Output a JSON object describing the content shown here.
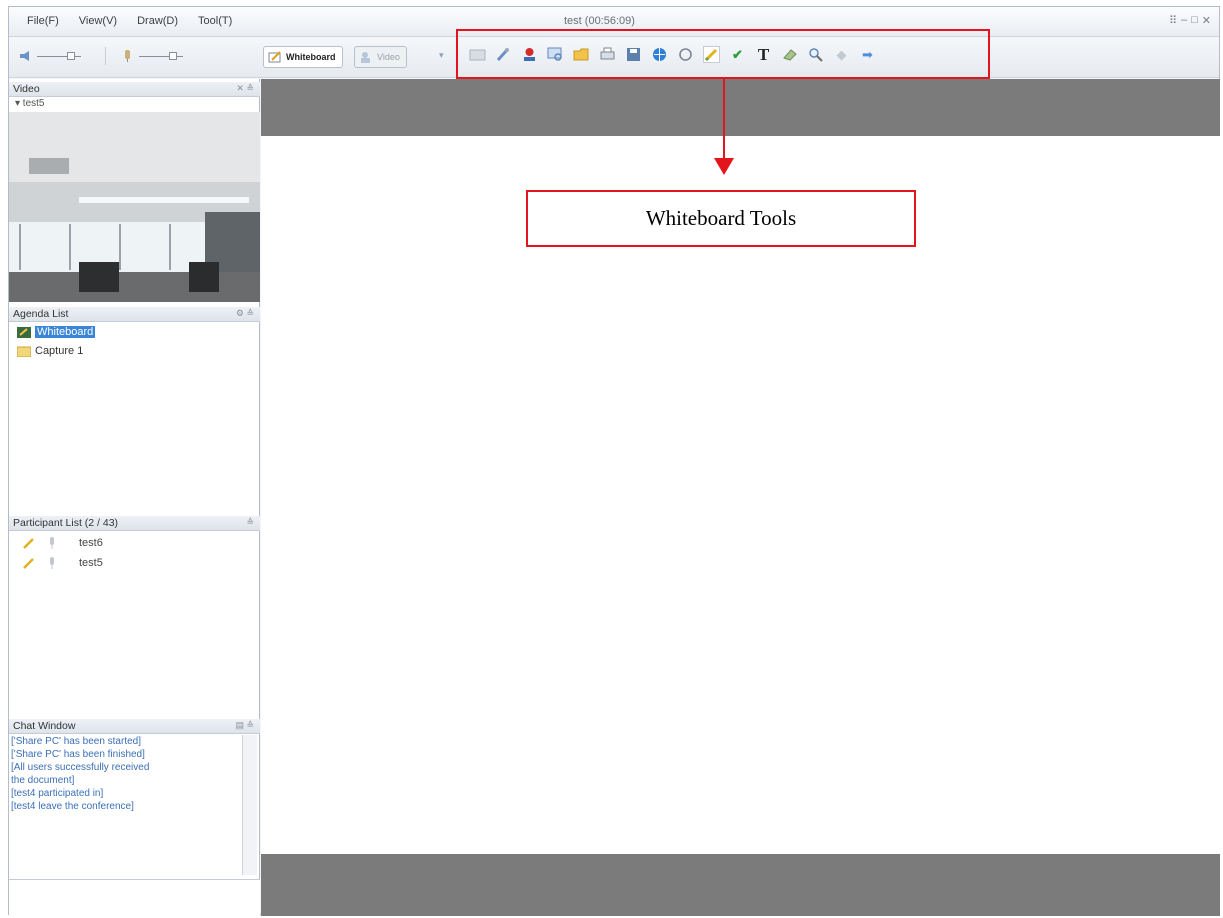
{
  "menu": {
    "file": "File(F)",
    "view": "View(V)",
    "draw": "Draw(D)",
    "tool": "Tool(T)"
  },
  "window": {
    "title": "test (00:56:09)",
    "controls": [
      "⠿",
      "–",
      "□",
      "✕"
    ]
  },
  "tabs": {
    "whiteboard": "Whiteboard",
    "video": "Video"
  },
  "toolbar_icons": [
    "slides-icon",
    "pointer-icon",
    "record-icon",
    "zoom-region-icon",
    "open-folder-icon",
    "print-icon",
    "save-icon",
    "globe-icon",
    "refresh-icon",
    "pen-icon",
    "check-icon",
    "text-icon",
    "eraser-icon",
    "magnifier-icon",
    "prev-page-icon",
    "next-page-icon"
  ],
  "annotation": {
    "label": "Whiteboard Tools"
  },
  "video_panel": {
    "header": "Video",
    "user": "▾ test5"
  },
  "agenda": {
    "header": "Agenda List",
    "items": [
      "Whiteboard",
      "Capture 1"
    ]
  },
  "participants": {
    "header": "Participant List (2 / 43)",
    "names": [
      "test6",
      "test5"
    ]
  },
  "chat": {
    "header": "Chat Window",
    "messages": [
      "['Share PC' has been started]",
      "['Share PC' has been finished]",
      "[All users successfully received",
      "the document]",
      "[test4 participated in]",
      "[test4 leave the conference]"
    ]
  },
  "colors": {
    "accent_red": "#e3141b",
    "selection_blue": "#3a85d6",
    "chat_text": "#3b6fb6",
    "whiteboard_margin": "#7b7b7b"
  }
}
